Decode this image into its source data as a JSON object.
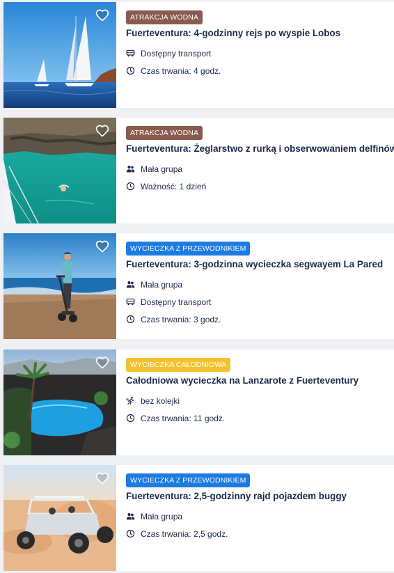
{
  "colors": {
    "badge_water": "#8a5a4e",
    "badge_guided": "#1c7be0",
    "badge_fullday": "#f2c230",
    "title": "#1b2a4a"
  },
  "cards": [
    {
      "badge": "ATRAKCJA WODNA",
      "title": "Fuerteventura: 4-godzinny rejs po wyspie Lobos",
      "features": [
        {
          "icon": "bus-icon",
          "text": "Dostępny transport"
        },
        {
          "icon": "clock-icon",
          "text": "Czas trwania: 4 godz."
        }
      ]
    },
    {
      "badge": "ATRAKCJA WODNA",
      "title": "Fuerteventura: Żeglarstwo z rurką i obserwowaniem delfinów",
      "features": [
        {
          "icon": "group-icon",
          "text": "Mała grupa"
        },
        {
          "icon": "clock-icon",
          "text": "Ważność: 1 dzień"
        }
      ]
    },
    {
      "badge": "WYCIECZKA Z PRZEWODNIKIEM",
      "title": "Fuerteventura: 3-godzinna wycieczka segwayem La Pared",
      "features": [
        {
          "icon": "group-icon",
          "text": "Mała grupa"
        },
        {
          "icon": "bus-icon",
          "text": "Dostępny transport"
        },
        {
          "icon": "clock-icon",
          "text": "Czas trwania: 3 godz."
        }
      ]
    },
    {
      "badge": "WYCIECZKA CAŁODNIOWA",
      "title": "Całodniowa wycieczka na Lanzarote z Fuerteventury",
      "features": [
        {
          "icon": "running-person-icon",
          "text": "bez kolejki"
        },
        {
          "icon": "clock-icon",
          "text": "Czas trwania: 11 godz."
        }
      ]
    },
    {
      "badge": "WYCIECZKA Z PRZEWODNIKIEM",
      "title": "Fuerteventura: 2,5-godzinny rajd pojazdem buggy",
      "features": [
        {
          "icon": "group-icon",
          "text": "Mała grupa"
        },
        {
          "icon": "clock-icon",
          "text": "Czas trwania: 2,5 godz."
        }
      ]
    }
  ]
}
